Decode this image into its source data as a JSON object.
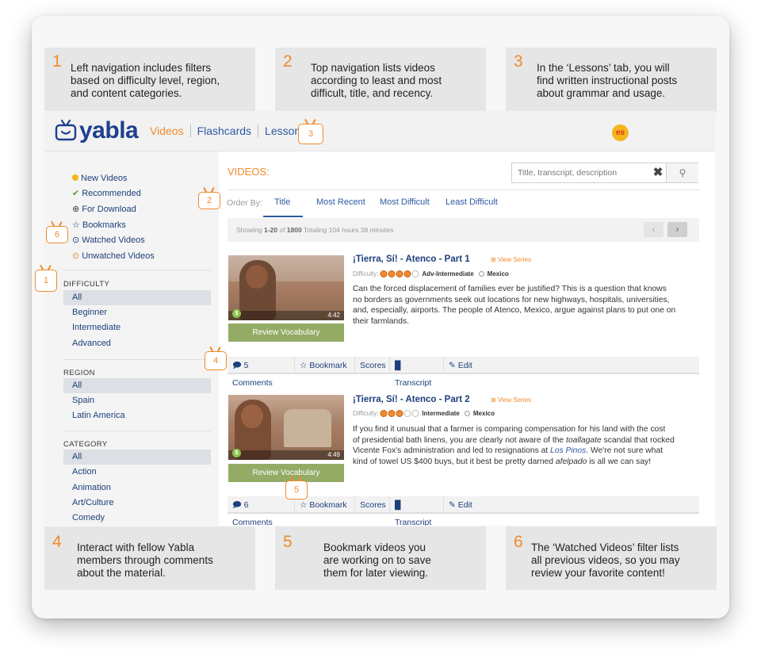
{
  "callouts": [
    {
      "num": "1",
      "text_lines": [
        "Left navigation includes filters",
        "based on difficulty level, region,",
        "and content categories."
      ]
    },
    {
      "num": "2",
      "text_lines": [
        "Top navigation lists videos",
        "according to least and most",
        "difficult, title, and recency."
      ]
    },
    {
      "num": "3",
      "text_lines": [
        "In the ‘Lessons’ tab, you will",
        "find written instructional posts",
        "about grammar and usage."
      ]
    },
    {
      "num": "4",
      "text_lines": [
        "Interact with fellow Yabla",
        "members through comments",
        "about the material."
      ]
    },
    {
      "num": "5",
      "text_lines": [
        "Bookmark videos you",
        "are working on to save",
        "them for later viewing."
      ]
    },
    {
      "num": "6",
      "text_lines": [
        "The ‘Watched Videos’ filter lists",
        "all previous videos, so you may",
        "review your favorite content!"
      ]
    }
  ],
  "app": {
    "logo": "yabla",
    "nav": [
      "Videos",
      "Flashcards",
      "Lessons"
    ],
    "lang_badge": "es",
    "colors": {
      "accent": "#f08a2c",
      "link": "#2d5aa0",
      "navy": "#1f3f8f",
      "review": "#93ab65",
      "lang": "#f5b41b"
    }
  },
  "sidebar": {
    "filters": [
      {
        "icon": "yellow-dot-icon",
        "glyph": "",
        "label": "New Videos"
      },
      {
        "icon": "check-icon",
        "glyph": "✔",
        "label": "Recommended"
      },
      {
        "icon": "download-circle-icon",
        "glyph": "⊕",
        "label": "For Download"
      },
      {
        "icon": "star-outline-icon",
        "glyph": "☆",
        "label": "Bookmarks"
      },
      {
        "icon": "clock-icon",
        "glyph": "⊙",
        "label": "Watched Videos"
      },
      {
        "icon": "clock-orange-icon",
        "glyph": "⊙",
        "label": "Unwatched Videos"
      }
    ],
    "difficulty": {
      "title": "DIFFICULTY",
      "options": [
        "All",
        "Beginner",
        "Intermediate",
        "Advanced"
      ]
    },
    "region": {
      "title": "REGION",
      "options": [
        "All",
        "Spain",
        "Latin America"
      ]
    },
    "category": {
      "title": "CATEGORY",
      "options": [
        "All",
        "Action",
        "Animation",
        "Art/Culture",
        "Comedy"
      ]
    }
  },
  "main": {
    "title": "VIDEOS:",
    "search": {
      "placeholder": "Title, transcript, description",
      "clear": "✖",
      "btn": "⚲"
    },
    "order_label": "Order By:",
    "order_tabs": [
      "Title",
      "Most Recent",
      "Most Difficult",
      "Least Difficult"
    ],
    "showing": {
      "prefix": "Showing ",
      "range": "1-20",
      "of": " of ",
      "total": "1800",
      "suffix": " Totaling 104 hours 38 minutes"
    },
    "pager": {
      "prev": "‹",
      "next": "›"
    },
    "videos": [
      {
        "title": "¡Tierra, Sí! - Atenco - Part 1",
        "view_series": "⊞ View Series",
        "difficulty_label": "Difficulty:",
        "level": "Adv-Intermediate",
        "level_rating": 4,
        "region": "Mexico",
        "duration": "4:42",
        "review_label": "Review Vocabulary",
        "desc_lines": [
          "Can the forced displacement of families ever be justified? This is a question that knows",
          "no borders as governments seek out locations for new highways, hospitals, universities,",
          "and, especially, airports. The people of Atenco, Mexico, argue against plans to put one on",
          "their farmlands."
        ],
        "actions": [
          "5 Comments",
          "Bookmark",
          "Scores",
          "Transcript",
          "Edit"
        ]
      },
      {
        "title": "¡Tierra, Sí! - Atenco - Part 2",
        "view_series": "⊞ View Series",
        "difficulty_label": "Difficulty:",
        "level": "Intermediate",
        "level_rating": 3,
        "region": "Mexico",
        "duration": "4:49",
        "review_label": "Review Vocabulary",
        "desc": {
          "l1": "If you find it unusual that a farmer is comparing compensation for his land with the cost",
          "l2a": "of presidential bath linens, you are clearly not aware of the ",
          "l2b": "toallagate",
          "l2c": " scandal that rocked",
          "l3a": "Vicente Fox's administration and led to resignations at ",
          "l3b": "Los Pinos",
          "l3c": ". We're not sure what",
          "l4a": "kind of towel US $400 buys, but it best be pretty darned ",
          "l4b": "afelpado",
          "l4c": " is all we can say!"
        },
        "actions": [
          "6 Comments",
          "Bookmark",
          "Scores",
          "Transcript",
          "Edit"
        ]
      }
    ]
  },
  "markers": [
    "1",
    "2",
    "3",
    "4",
    "5",
    "6"
  ]
}
